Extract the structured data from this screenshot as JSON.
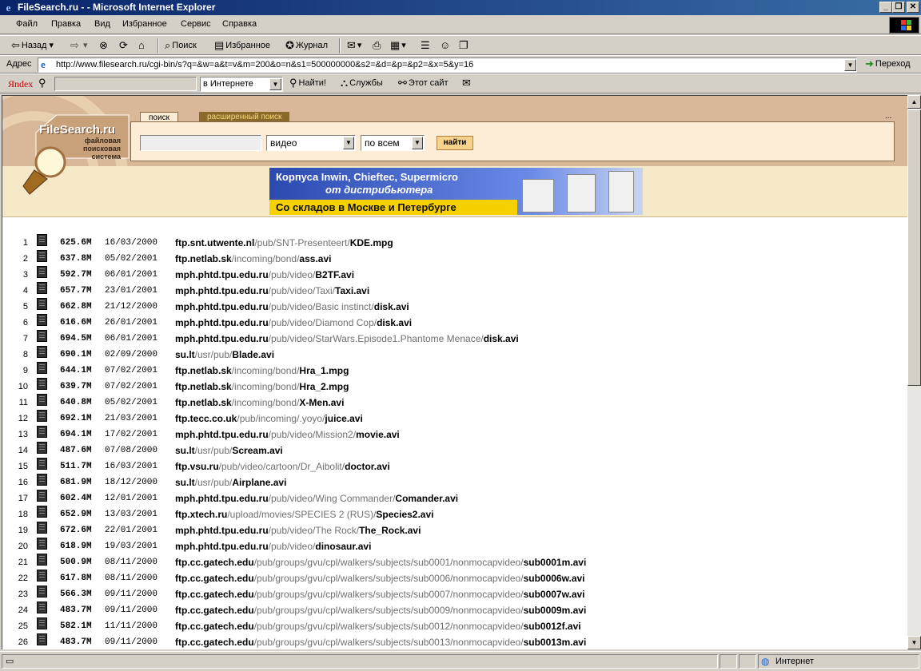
{
  "window": {
    "title": "FileSearch.ru - - Microsoft Internet Explorer"
  },
  "menu": [
    "Файл",
    "Правка",
    "Вид",
    "Избранное",
    "Сервис",
    "Справка"
  ],
  "toolbar": {
    "back": "Назад",
    "search": "Поиск",
    "favorites": "Избранное",
    "history": "Журнал"
  },
  "address": {
    "label": "Адрес",
    "url": "http://www.filesearch.ru/cgi-bin/s?q=&w=a&t=v&m=200&o=n&s1=500000000&s2=&d=&p=&p2=&x=5&y=16",
    "go": "Переход"
  },
  "yandex": {
    "logo": "Яndex",
    "scope": "в Интернете",
    "find": "Найти!",
    "services": "Службы",
    "this_site": "Этот сайт"
  },
  "page": {
    "logo": "FileSearch.ru",
    "logo_sub": [
      "файловая",
      "поисковая",
      "система"
    ],
    "tab_search": "поиск",
    "tab_advanced": "расширенный поиск",
    "more": "...",
    "type_select": "видео",
    "scope_select": "по всем",
    "find_button": "найти",
    "banner": {
      "line1": "Корпуса Inwin, Chieftec, Supermicro",
      "line2": "от дистрибьютера",
      "line3": "Со складов в Москве и Петербурге"
    }
  },
  "results": [
    {
      "n": "1",
      "size": "625.6M",
      "date": "16/03/2000",
      "host": "ftp.snt.utwente.nl",
      "dir": "/pub/SNT-Presenteert/",
      "file": "KDE.mpg"
    },
    {
      "n": "2",
      "size": "637.8M",
      "date": "05/02/2001",
      "host": "ftp.netlab.sk",
      "dir": "/incoming/bond/",
      "file": "ass.avi"
    },
    {
      "n": "3",
      "size": "592.7M",
      "date": "06/01/2001",
      "host": "mph.phtd.tpu.edu.ru",
      "dir": "/pub/video/",
      "file": "B2TF.avi"
    },
    {
      "n": "4",
      "size": "657.7M",
      "date": "23/01/2001",
      "host": "mph.phtd.tpu.edu.ru",
      "dir": "/pub/video/Taxi/",
      "file": "Taxi.avi"
    },
    {
      "n": "5",
      "size": "662.8M",
      "date": "21/12/2000",
      "host": "mph.phtd.tpu.edu.ru",
      "dir": "/pub/video/Basic instinct/",
      "file": "disk.avi"
    },
    {
      "n": "6",
      "size": "616.6M",
      "date": "26/01/2001",
      "host": "mph.phtd.tpu.edu.ru",
      "dir": "/pub/video/Diamond Cop/",
      "file": "disk.avi"
    },
    {
      "n": "7",
      "size": "694.5M",
      "date": "06/01/2001",
      "host": "mph.phtd.tpu.edu.ru",
      "dir": "/pub/video/StarWars.Episode1.Phantome Menace/",
      "file": "disk.avi"
    },
    {
      "n": "8",
      "size": "690.1M",
      "date": "02/09/2000",
      "host": "su.lt",
      "dir": "/usr/pub/",
      "file": "Blade.avi"
    },
    {
      "n": "9",
      "size": "644.1M",
      "date": "07/02/2001",
      "host": "ftp.netlab.sk",
      "dir": "/incoming/bond/",
      "file": "Hra_1.mpg"
    },
    {
      "n": "10",
      "size": "639.7M",
      "date": "07/02/2001",
      "host": "ftp.netlab.sk",
      "dir": "/incoming/bond/",
      "file": "Hra_2.mpg"
    },
    {
      "n": "11",
      "size": "640.8M",
      "date": "05/02/2001",
      "host": "ftp.netlab.sk",
      "dir": "/incoming/bond/",
      "file": "X-Men.avi"
    },
    {
      "n": "12",
      "size": "692.1M",
      "date": "21/03/2001",
      "host": "ftp.tecc.co.uk",
      "dir": "/pub/incoming/.yoyo/",
      "file": "juice.avi"
    },
    {
      "n": "13",
      "size": "694.1M",
      "date": "17/02/2001",
      "host": "mph.phtd.tpu.edu.ru",
      "dir": "/pub/video/Mission2/",
      "file": "movie.avi"
    },
    {
      "n": "14",
      "size": "487.6M",
      "date": "07/08/2000",
      "host": "su.lt",
      "dir": "/usr/pub/",
      "file": "Scream.avi"
    },
    {
      "n": "15",
      "size": "511.7M",
      "date": "16/03/2001",
      "host": "ftp.vsu.ru",
      "dir": "/pub/video/cartoon/Dr_Aibolit/",
      "file": "doctor.avi"
    },
    {
      "n": "16",
      "size": "681.9M",
      "date": "18/12/2000",
      "host": "su.lt",
      "dir": "/usr/pub/",
      "file": "Airplane.avi"
    },
    {
      "n": "17",
      "size": "602.4M",
      "date": "12/01/2001",
      "host": "mph.phtd.tpu.edu.ru",
      "dir": "/pub/video/Wing Commander/",
      "file": "Comander.avi"
    },
    {
      "n": "18",
      "size": "652.9M",
      "date": "13/03/2001",
      "host": "ftp.xtech.ru",
      "dir": "/upload/movies/SPECIES 2 (RUS)/",
      "file": "Species2.avi"
    },
    {
      "n": "19",
      "size": "672.6M",
      "date": "22/01/2001",
      "host": "mph.phtd.tpu.edu.ru",
      "dir": "/pub/video/The Rock/",
      "file": "The_Rock.avi"
    },
    {
      "n": "20",
      "size": "618.9M",
      "date": "19/03/2001",
      "host": "mph.phtd.tpu.edu.ru",
      "dir": "/pub/video/",
      "file": "dinosaur.avi"
    },
    {
      "n": "21",
      "size": "500.9M",
      "date": "08/11/2000",
      "host": "ftp.cc.gatech.edu",
      "dir": "/pub/groups/gvu/cpl/walkers/subjects/sub0001/nonmocapvideo/",
      "file": "sub0001m.avi"
    },
    {
      "n": "22",
      "size": "617.8M",
      "date": "08/11/2000",
      "host": "ftp.cc.gatech.edu",
      "dir": "/pub/groups/gvu/cpl/walkers/subjects/sub0006/nonmocapvideo/",
      "file": "sub0006w.avi"
    },
    {
      "n": "23",
      "size": "566.3M",
      "date": "09/11/2000",
      "host": "ftp.cc.gatech.edu",
      "dir": "/pub/groups/gvu/cpl/walkers/subjects/sub0007/nonmocapvideo/",
      "file": "sub0007w.avi"
    },
    {
      "n": "24",
      "size": "483.7M",
      "date": "09/11/2000",
      "host": "ftp.cc.gatech.edu",
      "dir": "/pub/groups/gvu/cpl/walkers/subjects/sub0009/nonmocapvideo/",
      "file": "sub0009m.avi"
    },
    {
      "n": "25",
      "size": "582.1M",
      "date": "11/11/2000",
      "host": "ftp.cc.gatech.edu",
      "dir": "/pub/groups/gvu/cpl/walkers/subjects/sub0012/nonmocapvideo/",
      "file": "sub0012f.avi"
    },
    {
      "n": "26",
      "size": "483.7M",
      "date": "09/11/2000",
      "host": "ftp.cc.gatech.edu",
      "dir": "/pub/groups/gvu/cpl/walkers/subjects/sub0013/nonmocapvideo/",
      "file": "sub0013m.avi"
    }
  ],
  "status": {
    "zone": "Интернет"
  }
}
